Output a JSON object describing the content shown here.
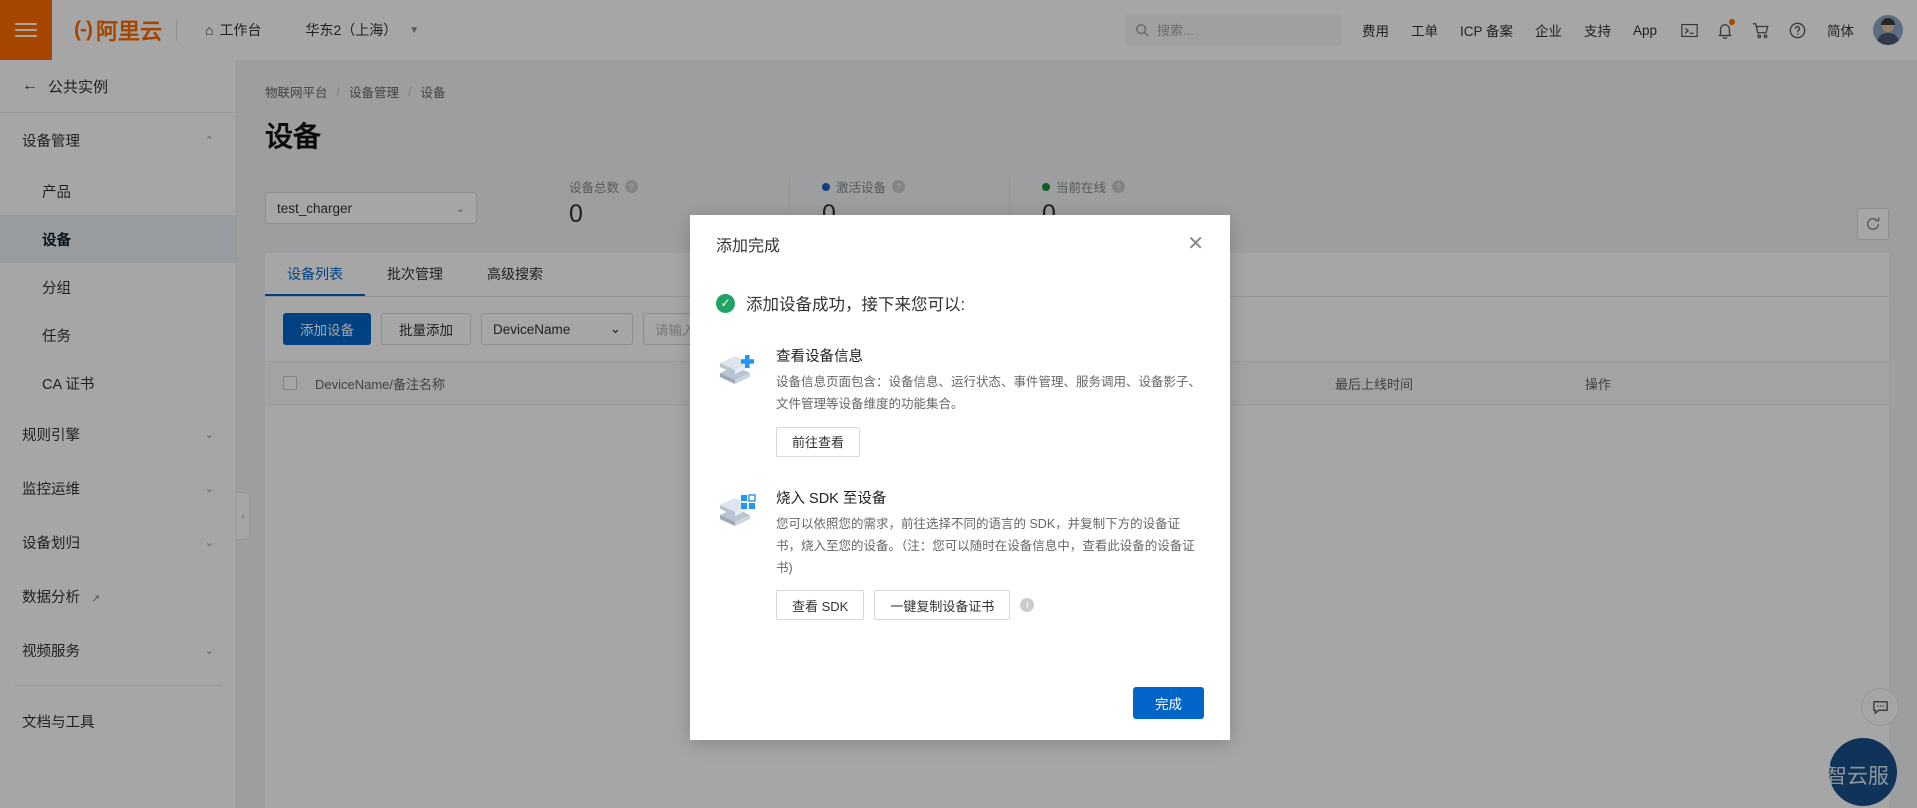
{
  "topbar": {
    "menu_icon": "hamburger-icon",
    "logo_text": "阿里云",
    "workbench": "工作台",
    "region": "华东2（上海）",
    "search_placeholder": "搜索...",
    "links": [
      "费用",
      "工单",
      "ICP 备案",
      "企业",
      "支持",
      "App"
    ],
    "icons": [
      "terminal-icon",
      "bell-icon",
      "cart-icon",
      "help-icon"
    ],
    "language": "简体"
  },
  "sidebar": {
    "back_label": "公共实例",
    "groups": [
      {
        "label": "设备管理",
        "expanded": true,
        "items": [
          {
            "label": "产品",
            "active": false
          },
          {
            "label": "设备",
            "active": true
          },
          {
            "label": "分组",
            "active": false
          },
          {
            "label": "任务",
            "active": false
          },
          {
            "label": "CA 证书",
            "active": false
          }
        ]
      },
      {
        "label": "规则引擎",
        "expanded": false,
        "items": []
      },
      {
        "label": "监控运维",
        "expanded": false,
        "items": []
      },
      {
        "label": "设备划归",
        "expanded": false,
        "items": []
      }
    ],
    "data_analysis": "数据分析",
    "video_service": "视频服务",
    "docs_tools": "文档与工具"
  },
  "main": {
    "breadcrumb": [
      "物联网平台",
      "设备管理",
      "设备"
    ],
    "title": "设备",
    "product_select": "test_charger",
    "stats": [
      {
        "label": "设备总数",
        "value": "0",
        "dot": ""
      },
      {
        "label": "激活设备",
        "value": "0",
        "dot": "#1a62c4"
      },
      {
        "label": "当前在线",
        "value": "0",
        "dot": "#1a8a3c"
      }
    ],
    "refresh_icon": "refresh-icon",
    "tabs": [
      {
        "label": "设备列表",
        "active": true
      },
      {
        "label": "批次管理",
        "active": false
      },
      {
        "label": "高级搜索",
        "active": false
      }
    ],
    "actions": {
      "add_device": "添加设备",
      "batch_add": "批量添加",
      "filter_field": "DeviceName",
      "search_placeholder": "请输入"
    },
    "table_headers": [
      "DeviceName/备注名称",
      "最后上线时间",
      "操作"
    ]
  },
  "modal": {
    "title": "添加完成",
    "close_icon": "close-icon",
    "success_text": "添加设备成功，接下来您可以:",
    "options": [
      {
        "icon": "device-info-icon",
        "title": "查看设备信息",
        "desc": "设备信息页面包含：设备信息、运行状态、事件管理、服务调用、设备影子、文件管理等设备维度的功能集合。",
        "buttons": [
          "前往查看"
        ],
        "has_info": false
      },
      {
        "icon": "sdk-burn-icon",
        "title": "烧入 SDK 至设备",
        "desc": "您可以依照您的需求，前往选择不同的语言的 SDK，并复制下方的设备证书，烧入至您的设备。（注：您可以随时在设备信息中，查看此设备的设备证书)",
        "buttons": [
          "查看 SDK",
          "一键复制设备证书"
        ],
        "has_info": true
      }
    ],
    "confirm": "完成"
  },
  "floating": {
    "feedback_icon": "feedback-icon",
    "watermark": "CSDN @智云服"
  },
  "colors": {
    "brand_orange": "#ff6a00",
    "primary_blue": "#0064c8",
    "success_green": "#21a366",
    "active_blue": "#1a62c4",
    "online_green": "#1a8a3c"
  }
}
